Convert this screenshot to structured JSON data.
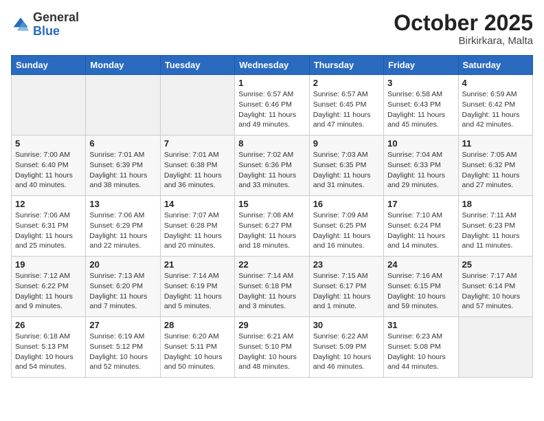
{
  "logo": {
    "general": "General",
    "blue": "Blue"
  },
  "header": {
    "month": "October 2025",
    "location": "Birkirkara, Malta"
  },
  "weekdays": [
    "Sunday",
    "Monday",
    "Tuesday",
    "Wednesday",
    "Thursday",
    "Friday",
    "Saturday"
  ],
  "weeks": [
    [
      {
        "day": "",
        "info": ""
      },
      {
        "day": "",
        "info": ""
      },
      {
        "day": "",
        "info": ""
      },
      {
        "day": "1",
        "info": "Sunrise: 6:57 AM\nSunset: 6:46 PM\nDaylight: 11 hours\nand 49 minutes."
      },
      {
        "day": "2",
        "info": "Sunrise: 6:57 AM\nSunset: 6:45 PM\nDaylight: 11 hours\nand 47 minutes."
      },
      {
        "day": "3",
        "info": "Sunrise: 6:58 AM\nSunset: 6:43 PM\nDaylight: 11 hours\nand 45 minutes."
      },
      {
        "day": "4",
        "info": "Sunrise: 6:59 AM\nSunset: 6:42 PM\nDaylight: 11 hours\nand 42 minutes."
      }
    ],
    [
      {
        "day": "5",
        "info": "Sunrise: 7:00 AM\nSunset: 6:40 PM\nDaylight: 11 hours\nand 40 minutes."
      },
      {
        "day": "6",
        "info": "Sunrise: 7:01 AM\nSunset: 6:39 PM\nDaylight: 11 hours\nand 38 minutes."
      },
      {
        "day": "7",
        "info": "Sunrise: 7:01 AM\nSunset: 6:38 PM\nDaylight: 11 hours\nand 36 minutes."
      },
      {
        "day": "8",
        "info": "Sunrise: 7:02 AM\nSunset: 6:36 PM\nDaylight: 11 hours\nand 33 minutes."
      },
      {
        "day": "9",
        "info": "Sunrise: 7:03 AM\nSunset: 6:35 PM\nDaylight: 11 hours\nand 31 minutes."
      },
      {
        "day": "10",
        "info": "Sunrise: 7:04 AM\nSunset: 6:33 PM\nDaylight: 11 hours\nand 29 minutes."
      },
      {
        "day": "11",
        "info": "Sunrise: 7:05 AM\nSunset: 6:32 PM\nDaylight: 11 hours\nand 27 minutes."
      }
    ],
    [
      {
        "day": "12",
        "info": "Sunrise: 7:06 AM\nSunset: 6:31 PM\nDaylight: 11 hours\nand 25 minutes."
      },
      {
        "day": "13",
        "info": "Sunrise: 7:06 AM\nSunset: 6:29 PM\nDaylight: 11 hours\nand 22 minutes."
      },
      {
        "day": "14",
        "info": "Sunrise: 7:07 AM\nSunset: 6:28 PM\nDaylight: 11 hours\nand 20 minutes."
      },
      {
        "day": "15",
        "info": "Sunrise: 7:08 AM\nSunset: 6:27 PM\nDaylight: 11 hours\nand 18 minutes."
      },
      {
        "day": "16",
        "info": "Sunrise: 7:09 AM\nSunset: 6:25 PM\nDaylight: 11 hours\nand 16 minutes."
      },
      {
        "day": "17",
        "info": "Sunrise: 7:10 AM\nSunset: 6:24 PM\nDaylight: 11 hours\nand 14 minutes."
      },
      {
        "day": "18",
        "info": "Sunrise: 7:11 AM\nSunset: 6:23 PM\nDaylight: 11 hours\nand 11 minutes."
      }
    ],
    [
      {
        "day": "19",
        "info": "Sunrise: 7:12 AM\nSunset: 6:22 PM\nDaylight: 11 hours\nand 9 minutes."
      },
      {
        "day": "20",
        "info": "Sunrise: 7:13 AM\nSunset: 6:20 PM\nDaylight: 11 hours\nand 7 minutes."
      },
      {
        "day": "21",
        "info": "Sunrise: 7:14 AM\nSunset: 6:19 PM\nDaylight: 11 hours\nand 5 minutes."
      },
      {
        "day": "22",
        "info": "Sunrise: 7:14 AM\nSunset: 6:18 PM\nDaylight: 11 hours\nand 3 minutes."
      },
      {
        "day": "23",
        "info": "Sunrise: 7:15 AM\nSunset: 6:17 PM\nDaylight: 11 hours\nand 1 minute."
      },
      {
        "day": "24",
        "info": "Sunrise: 7:16 AM\nSunset: 6:15 PM\nDaylight: 10 hours\nand 59 minutes."
      },
      {
        "day": "25",
        "info": "Sunrise: 7:17 AM\nSunset: 6:14 PM\nDaylight: 10 hours\nand 57 minutes."
      }
    ],
    [
      {
        "day": "26",
        "info": "Sunrise: 6:18 AM\nSunset: 5:13 PM\nDaylight: 10 hours\nand 54 minutes."
      },
      {
        "day": "27",
        "info": "Sunrise: 6:19 AM\nSunset: 5:12 PM\nDaylight: 10 hours\nand 52 minutes."
      },
      {
        "day": "28",
        "info": "Sunrise: 6:20 AM\nSunset: 5:11 PM\nDaylight: 10 hours\nand 50 minutes."
      },
      {
        "day": "29",
        "info": "Sunrise: 6:21 AM\nSunset: 5:10 PM\nDaylight: 10 hours\nand 48 minutes."
      },
      {
        "day": "30",
        "info": "Sunrise: 6:22 AM\nSunset: 5:09 PM\nDaylight: 10 hours\nand 46 minutes."
      },
      {
        "day": "31",
        "info": "Sunrise: 6:23 AM\nSunset: 5:08 PM\nDaylight: 10 hours\nand 44 minutes."
      },
      {
        "day": "",
        "info": ""
      }
    ]
  ]
}
